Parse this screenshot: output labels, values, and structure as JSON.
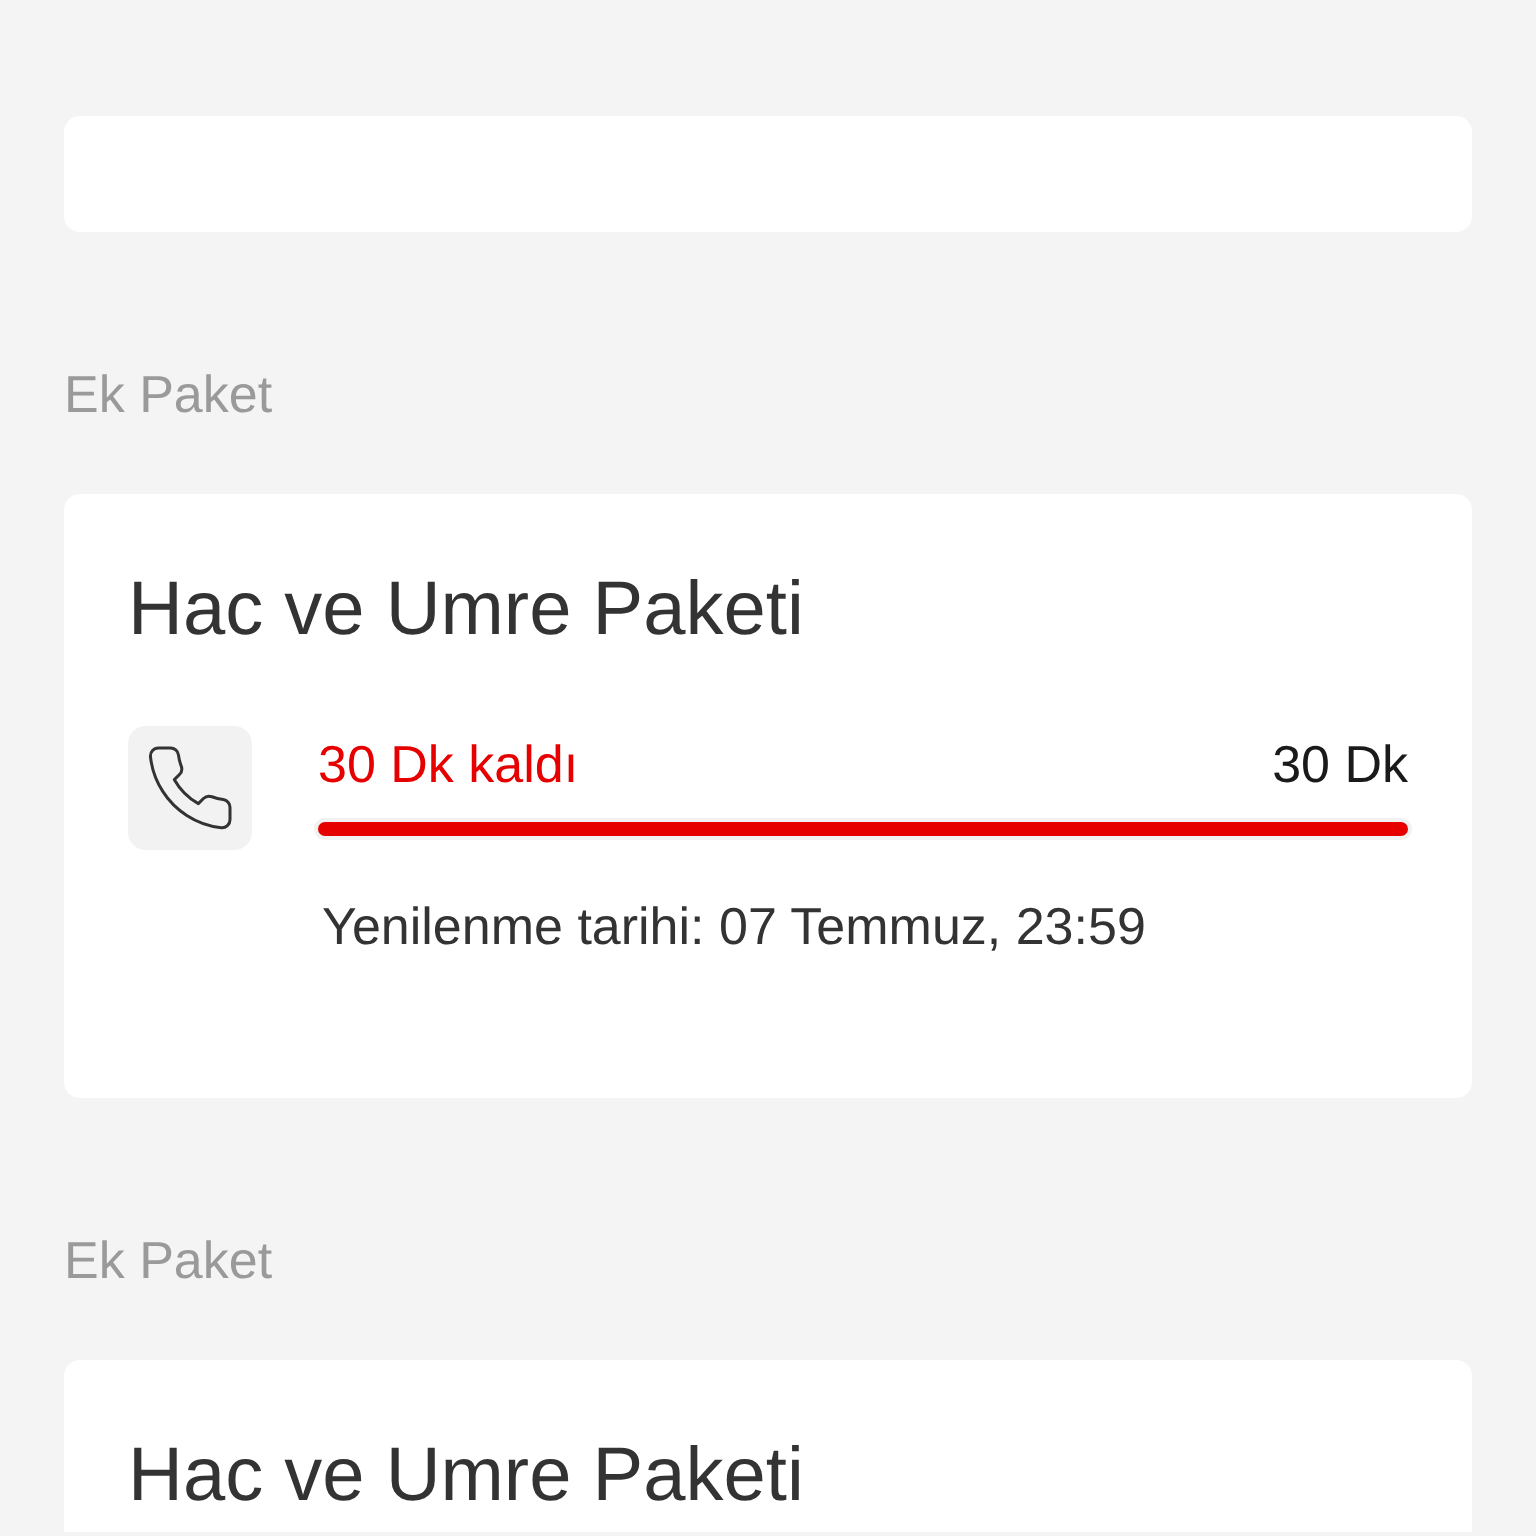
{
  "cards": [
    {
      "kind": "blank"
    },
    {
      "kind": "package",
      "heading": "Ek Paket",
      "title": "Hac ve Umre Paketi",
      "usage": {
        "remaining": "30 Dk kaldı",
        "total": "30 Dk",
        "level": 1,
        "renewal": "Yenilenme tarihi: 07 Temmuz, 23:59"
      }
    },
    {
      "kind": "package",
      "heading": "Ek Paket",
      "title": "Hac ve Umre Paketi"
    }
  ]
}
